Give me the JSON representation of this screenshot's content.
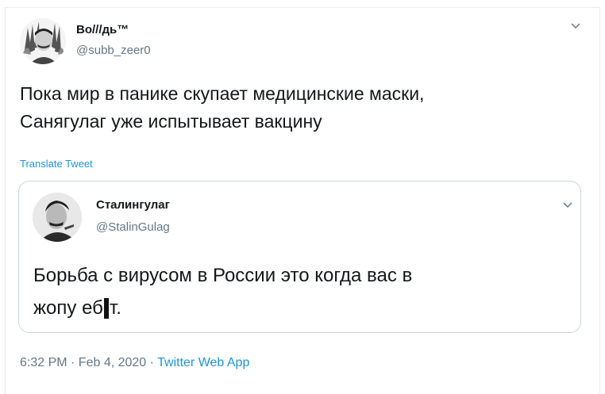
{
  "tweet": {
    "author_name": "Во///дь™",
    "author_handle": "@subb_zeer0",
    "text_line1": "Пока мир в панике скупает медицинские маски,",
    "text_line2": "Санягулаг уже испытывает вакцину",
    "translate_label": "Translate Tweet",
    "timestamp": "6:32 PM · Feb 4, 2020",
    "separator": " · ",
    "app": "Twitter Web App"
  },
  "quoted": {
    "author_name": "Сталингулаг",
    "author_handle": "@StalinGulag",
    "text_line1": "Борьба с вирусом в России это когда вас в",
    "text_line2_start": "жопу еб",
    "text_line2_end": "т."
  },
  "icons": {
    "menu": "chevron-down-icon",
    "avatar": "profile-avatar",
    "quoted_avatar": "profile-avatar"
  },
  "colors": {
    "link": "#1b95e0",
    "secondary": "#657786",
    "border": "#ccd6dd"
  }
}
